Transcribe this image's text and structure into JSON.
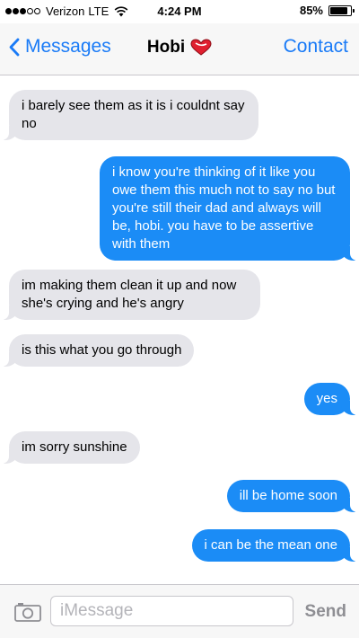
{
  "status_bar": {
    "carrier": "Verizon",
    "network": "LTE",
    "time": "4:24 PM",
    "battery": "85%",
    "signal_bars": 3,
    "signal_total": 5,
    "battery_level": 0.85
  },
  "nav": {
    "back_label": "Messages",
    "title": "Hobi",
    "title_icon": "red-heart-emoji",
    "contact_label": "Contact"
  },
  "messages": [
    {
      "direction": "in",
      "text": "i barely see them as it is i couldnt say no"
    },
    {
      "direction": "out",
      "text": "i know you're thinking of it like you owe them this much not to say no but you're still their dad and always will be, hobi. you have to be assertive with them"
    },
    {
      "direction": "in",
      "text": "im making them clean it up and now she's crying and he's angry"
    },
    {
      "direction": "in",
      "text": "is this what you go through"
    },
    {
      "direction": "out",
      "text": "yes"
    },
    {
      "direction": "in",
      "text": "im sorry sunshine"
    },
    {
      "direction": "out",
      "text": "ill be home soon"
    },
    {
      "direction": "out",
      "text": "i can be the mean one"
    }
  ],
  "input_bar": {
    "placeholder": "iMessage",
    "value": "",
    "send_label": "Send"
  },
  "colors": {
    "accent": "#1a7bf7",
    "outgoing_bubble": "#1b8cf6",
    "incoming_bubble": "#e5e5ea"
  }
}
